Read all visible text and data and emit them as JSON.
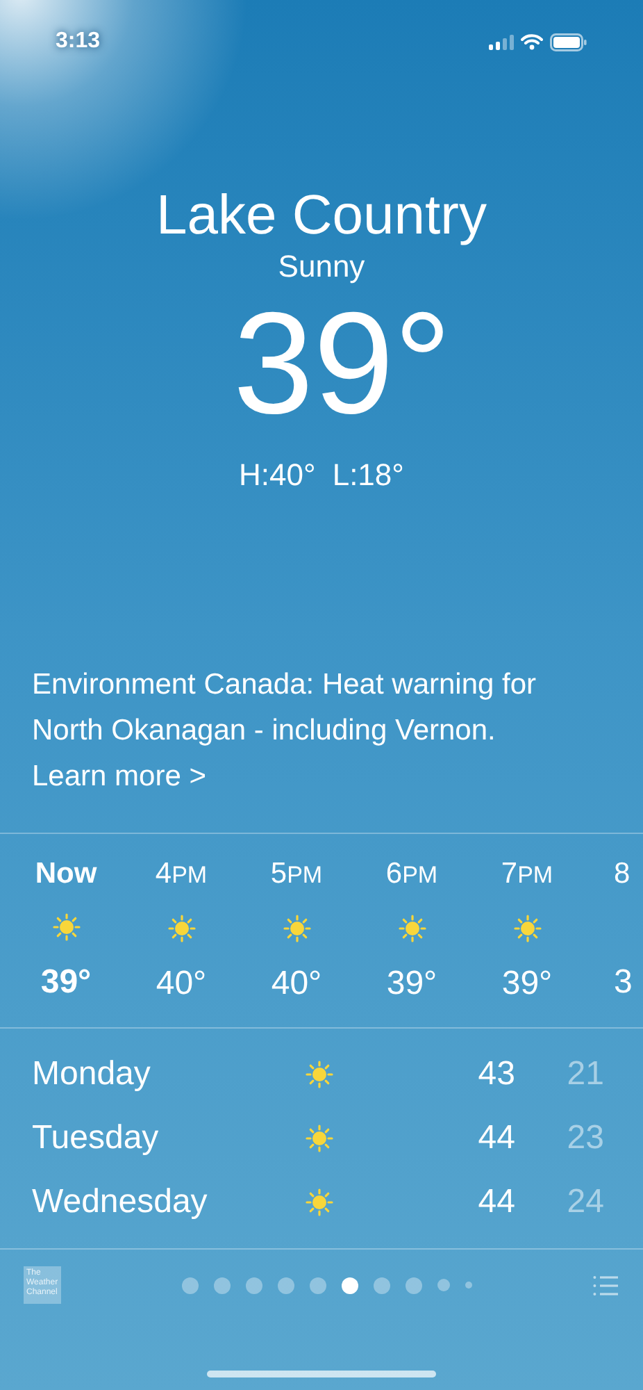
{
  "status_bar": {
    "time": "3:13"
  },
  "header": {
    "location": "Lake Country",
    "condition": "Sunny",
    "temperature": "39°",
    "high": "H:40°",
    "low": "L:18°"
  },
  "alert": {
    "text": "Environment Canada: Heat warning for North Okanagan - including Vernon.",
    "link": "Learn more",
    "chevron": ">"
  },
  "hourly": [
    {
      "kind": "full",
      "hour": "Now",
      "temp": "39°",
      "bold": true
    },
    {
      "kind": "full",
      "hour": "4",
      "suffix": "PM",
      "temp": "40°",
      "bold": false
    },
    {
      "kind": "full",
      "hour": "5",
      "suffix": "PM",
      "temp": "40°",
      "bold": false
    },
    {
      "kind": "full",
      "hour": "6",
      "suffix": "PM",
      "temp": "39°",
      "bold": false
    },
    {
      "kind": "full",
      "hour": "7",
      "suffix": "PM",
      "temp": "39°",
      "bold": false
    },
    {
      "kind": "partial",
      "hour": "8",
      "temp": "3",
      "bold": false
    }
  ],
  "daily": [
    {
      "day": "Monday",
      "high": "43",
      "low": "21"
    },
    {
      "day": "Tuesday",
      "high": "44",
      "low": "23"
    },
    {
      "day": "Wednesday",
      "high": "44",
      "low": "24"
    }
  ],
  "footer": {
    "logo": "The Weather Channel",
    "pages": [
      {
        "kind": "dot",
        "selected": false
      },
      {
        "kind": "dot",
        "selected": false
      },
      {
        "kind": "dot",
        "selected": false
      },
      {
        "kind": "dot",
        "selected": false
      },
      {
        "kind": "dot",
        "selected": false
      },
      {
        "kind": "dot",
        "selected": true
      },
      {
        "kind": "dot",
        "selected": false
      },
      {
        "kind": "dot",
        "selected": false
      },
      {
        "kind": "small",
        "selected": false
      },
      {
        "kind": "tiny",
        "selected": false
      }
    ]
  }
}
